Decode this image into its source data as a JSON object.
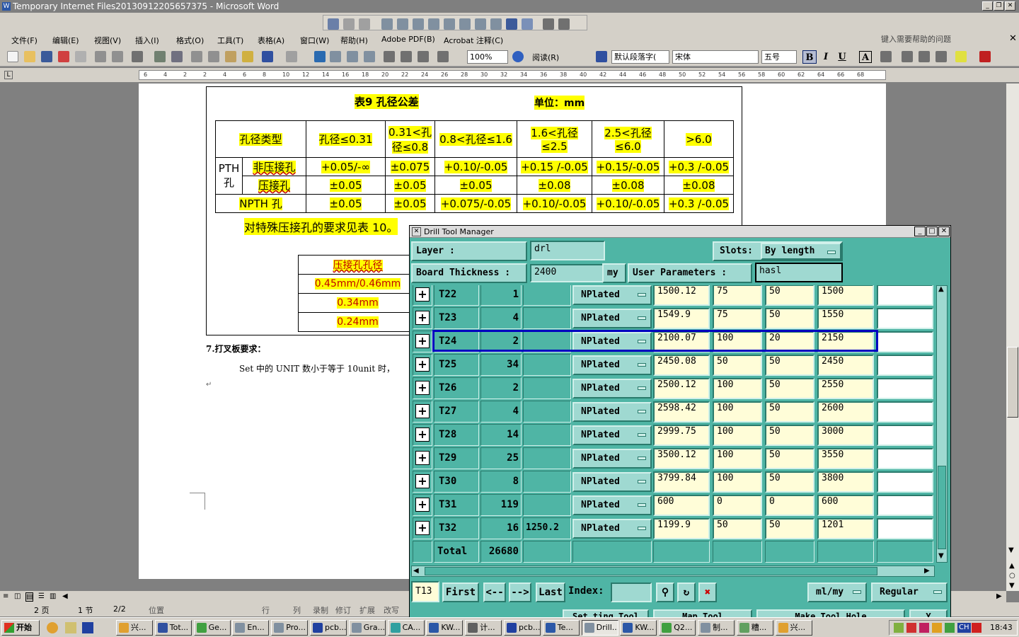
{
  "window": {
    "title": "Temporary Internet Files20130912205657375 - Microsoft Word",
    "title_icon": "W"
  },
  "menu": {
    "items": [
      "文件(F)",
      "编辑(E)",
      "视图(V)",
      "插入(I)",
      "格式(O)",
      "工具(T)",
      "表格(A)",
      "窗口(W)",
      "帮助(H)",
      "Adobe PDF(B)",
      "Acrobat 注释(C)"
    ],
    "help_placeholder": "键入需要帮助的问题"
  },
  "toolbar": {
    "zoom": "100%",
    "read_label": "阅读(R)",
    "style": "默认段落字(",
    "font": "宋体",
    "size": "五号",
    "bold": "B",
    "italic": "I",
    "underline": "U",
    "char_border": "A"
  },
  "ruler": {
    "ticks": [
      "6",
      "4",
      "2",
      "2",
      "4",
      "6",
      "8",
      "10",
      "12",
      "14",
      "16",
      "18",
      "20",
      "22",
      "24",
      "26",
      "28",
      "30",
      "32",
      "34",
      "36",
      "38",
      "40",
      "42",
      "44",
      "46",
      "48",
      "50",
      "52",
      "54",
      "56",
      "58",
      "60",
      "62",
      "64",
      "66",
      "68"
    ]
  },
  "document": {
    "table_title": "表9   孔径公差",
    "unit_label": "单位：mm",
    "headers": [
      "孔径类型",
      "孔径≤0.31",
      "0.31<孔径≤0.8",
      "0.8<孔径≤1.6",
      "1.6<孔径≤2.5",
      "2.5<孔径≤6.0",
      ">6.0"
    ],
    "pth_label": "PTH孔",
    "rows": [
      {
        "type": "非压接孔",
        "values": [
          "+0.05/-∞",
          "±0.075",
          "+0.10/-0.05",
          "+0.15 /-0.05",
          "+0.15/-0.05",
          "+0.3 /-0.05"
        ]
      },
      {
        "type": "压接孔",
        "values": [
          "±0.05",
          "±0.05",
          "±0.05",
          "±0.08",
          "±0.08",
          "±0.08"
        ]
      },
      {
        "type": "NPTH 孔",
        "values": [
          "±0.05",
          "±0.05",
          "+0.075/-0.05",
          "+0.10/-0.05",
          "+0.10/-0.05",
          "+0.3 /-0.05"
        ]
      }
    ],
    "special_note": "对特殊压接孔的要求见表 10。",
    "sub_table": [
      "压接孔孔径",
      "0.45mm/0.46mm",
      "0.34mm",
      "0.24mm"
    ],
    "section_heading": "7.打叉板要求：",
    "section_text": "Set 中的 UNIT 数小于等于 10unit 时，"
  },
  "statusbar": {
    "page": "2 页",
    "section": "1 节",
    "pages": "2/2",
    "position": "位置",
    "line": "行",
    "col": "列",
    "rec": "录制",
    "trk": "修订",
    "ext": "扩展",
    "ovr": "改写"
  },
  "dialog": {
    "title": "Drill Tool Manager",
    "layer_label": "Layer           :",
    "layer_value": "drl",
    "slots_label": "Slots:",
    "slots_value": "By length",
    "board_thickness_label": "Board Thickness  :",
    "board_thickness_value": "2400",
    "thickness_unit": "my",
    "user_params_label": "User Parameters  :",
    "user_params_value": "hasl",
    "rows": [
      {
        "tool": "T22",
        "count": "1",
        "slot": "",
        "type": "NPlated",
        "finish": "1500.12",
        "tol_plus": "75",
        "tol_minus": "50",
        "drill": "1500",
        "extra": ""
      },
      {
        "tool": "T23",
        "count": "4",
        "slot": "",
        "type": "NPlated",
        "finish": "1549.9",
        "tol_plus": "75",
        "tol_minus": "50",
        "drill": "1550",
        "extra": ""
      },
      {
        "tool": "T24",
        "count": "2",
        "slot": "",
        "type": "NPlated",
        "finish": "2100.07",
        "tol_plus": "100",
        "tol_minus": "20",
        "drill": "2150",
        "extra": ""
      },
      {
        "tool": "T25",
        "count": "34",
        "slot": "",
        "type": "NPlated",
        "finish": "2450.08",
        "tol_plus": "50",
        "tol_minus": "50",
        "drill": "2450",
        "extra": ""
      },
      {
        "tool": "T26",
        "count": "2",
        "slot": "",
        "type": "NPlated",
        "finish": "2500.12",
        "tol_plus": "100",
        "tol_minus": "50",
        "drill": "2550",
        "extra": ""
      },
      {
        "tool": "T27",
        "count": "4",
        "slot": "",
        "type": "NPlated",
        "finish": "2598.42",
        "tol_plus": "100",
        "tol_minus": "50",
        "drill": "2600",
        "extra": ""
      },
      {
        "tool": "T28",
        "count": "14",
        "slot": "",
        "type": "NPlated",
        "finish": "2999.75",
        "tol_plus": "100",
        "tol_minus": "50",
        "drill": "3000",
        "extra": ""
      },
      {
        "tool": "T29",
        "count": "25",
        "slot": "",
        "type": "NPlated",
        "finish": "3500.12",
        "tol_plus": "100",
        "tol_minus": "50",
        "drill": "3550",
        "extra": ""
      },
      {
        "tool": "T30",
        "count": "8",
        "slot": "",
        "type": "NPlated",
        "finish": "3799.84",
        "tol_plus": "100",
        "tol_minus": "50",
        "drill": "3800",
        "extra": ""
      },
      {
        "tool": "T31",
        "count": "119",
        "slot": "",
        "type": "NPlated",
        "finish": "600",
        "tol_plus": "0",
        "tol_minus": "0",
        "drill": "600",
        "extra": ""
      },
      {
        "tool": "T32",
        "count": "16",
        "slot": "1250.2",
        "type": "NPlated",
        "finish": "1199.9",
        "tol_plus": "50",
        "tol_minus": "50",
        "drill": "1201",
        "extra": ""
      }
    ],
    "highlighted_row": "T24",
    "total_label": "Total",
    "total_value": "26680",
    "current_tool": "T13",
    "first_label": "First",
    "prev_label": "<--",
    "next_label": "-->",
    "last_label": "Last",
    "index_label": "Index:",
    "units_value": "ml/my",
    "mode_value": "Regular",
    "bottom_partial": [
      "Set ting Tool",
      "Map Tool",
      "Make Tool Hole",
      "Y"
    ]
  },
  "taskbar": {
    "start": "开始",
    "tasks": [
      "兴...",
      "Tot...",
      "Ge...",
      "En...",
      "Pro...",
      "pcb...",
      "Gra...",
      "CA...",
      "KW...",
      "计...",
      "pcb...",
      "Te...",
      "Drill...",
      "KW...",
      "Q2...",
      "制...",
      "糟...",
      "兴..."
    ],
    "active_task": "Drill...",
    "clock": "18:43",
    "lang": "CH"
  },
  "colors": {
    "dialog_bg": "#4fb5a5",
    "highlight": "#ffff00",
    "selection_border": "#0000c0"
  }
}
